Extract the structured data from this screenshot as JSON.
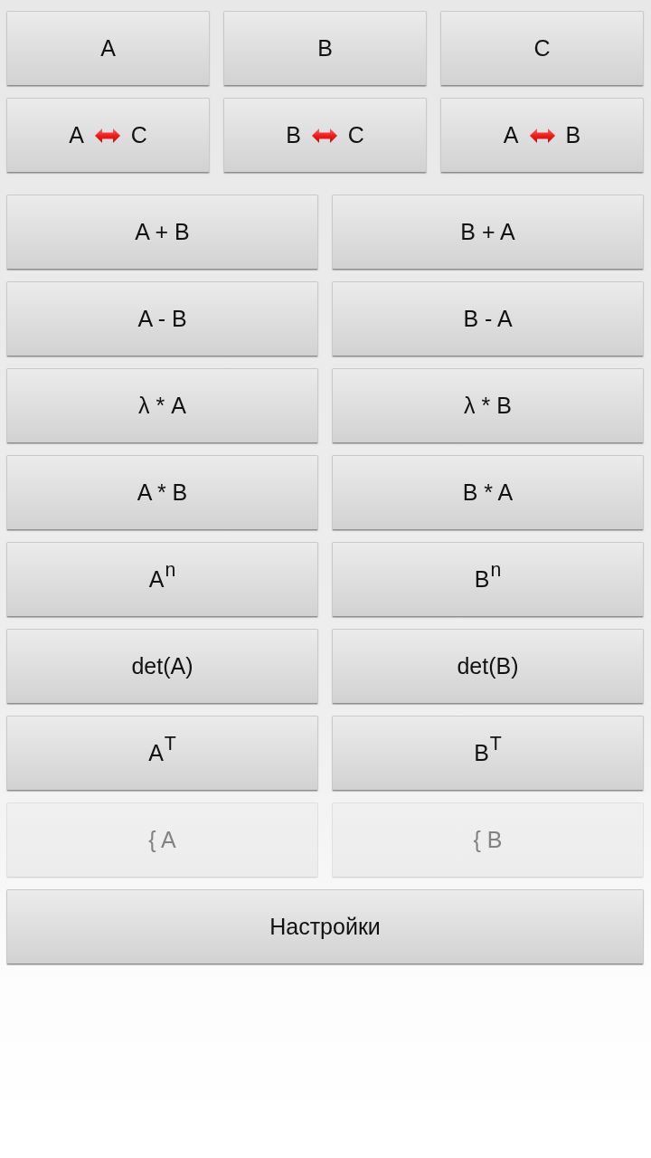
{
  "matrix_buttons": [
    {
      "label": "A"
    },
    {
      "label": "B"
    },
    {
      "label": "C"
    }
  ],
  "swap_buttons": [
    {
      "left": "A",
      "right": "C"
    },
    {
      "left": "B",
      "right": "C"
    },
    {
      "left": "A",
      "right": "B"
    }
  ],
  "operation_buttons": [
    {
      "label": "A + B",
      "disabled": false
    },
    {
      "label": "B + A",
      "disabled": false
    },
    {
      "label": "A - B",
      "disabled": false
    },
    {
      "label": "B - A",
      "disabled": false
    },
    {
      "label": "λ * A",
      "disabled": false
    },
    {
      "label": "λ * B",
      "disabled": false
    },
    {
      "label": "A * B",
      "disabled": false
    },
    {
      "label": "B * A",
      "disabled": false
    },
    {
      "label": "A$^{n}$",
      "disabled": false
    },
    {
      "label": "B$^{n}$",
      "disabled": false
    },
    {
      "label": "det(A)",
      "disabled": false
    },
    {
      "label": "det(B)",
      "disabled": false
    },
    {
      "label": "A$^{T}$",
      "disabled": false
    },
    {
      "label": "B$^{T}$",
      "disabled": false
    },
    {
      "label": "{ A",
      "disabled": true
    },
    {
      "label": "{ B",
      "disabled": true
    }
  ],
  "settings_button": {
    "label": "Настройки"
  }
}
